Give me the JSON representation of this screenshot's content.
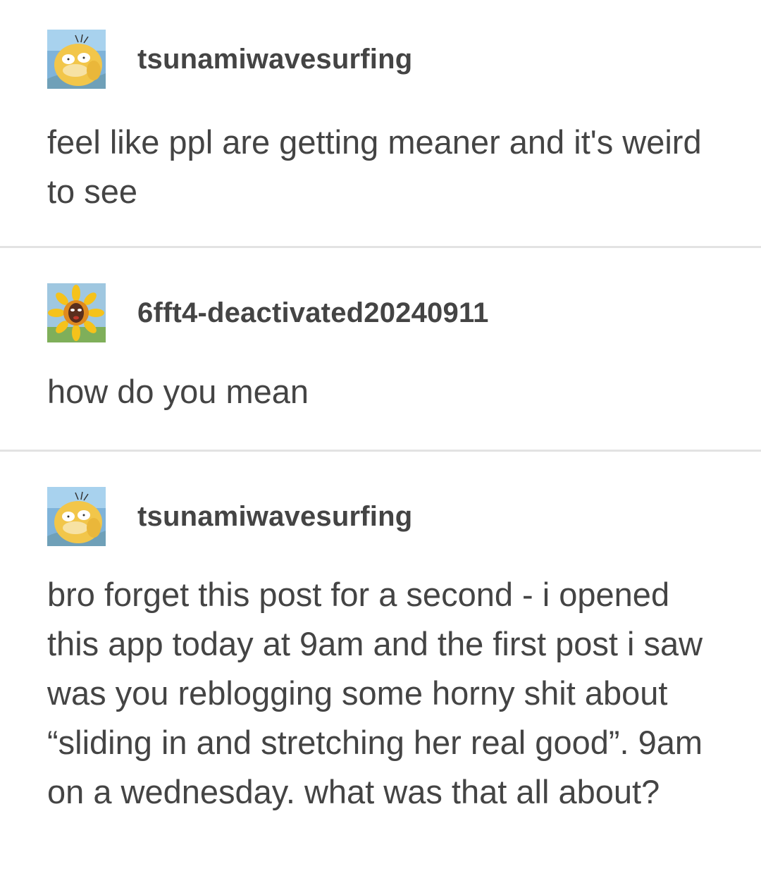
{
  "posts": [
    {
      "username": "tsunamiwavesurfing",
      "avatar_icon": "psyduck-avatar",
      "body": "feel like ppl are getting meaner and it's weird to see"
    },
    {
      "username": "6fft4-deactivated20240911",
      "avatar_icon": "sunflower-face-avatar",
      "body": "how do you mean"
    },
    {
      "username": "tsunamiwavesurfing",
      "avatar_icon": "psyduck-avatar",
      "body": "bro forget this post for a second - i opened this app today at 9am and the first post i saw was you reblogging some horny shit about “sliding in and stretching her real good”. 9am on a wednesday. what was that all about?"
    }
  ],
  "colors": {
    "text": "#444444",
    "divider": "#e3e3e3",
    "background": "#ffffff"
  }
}
